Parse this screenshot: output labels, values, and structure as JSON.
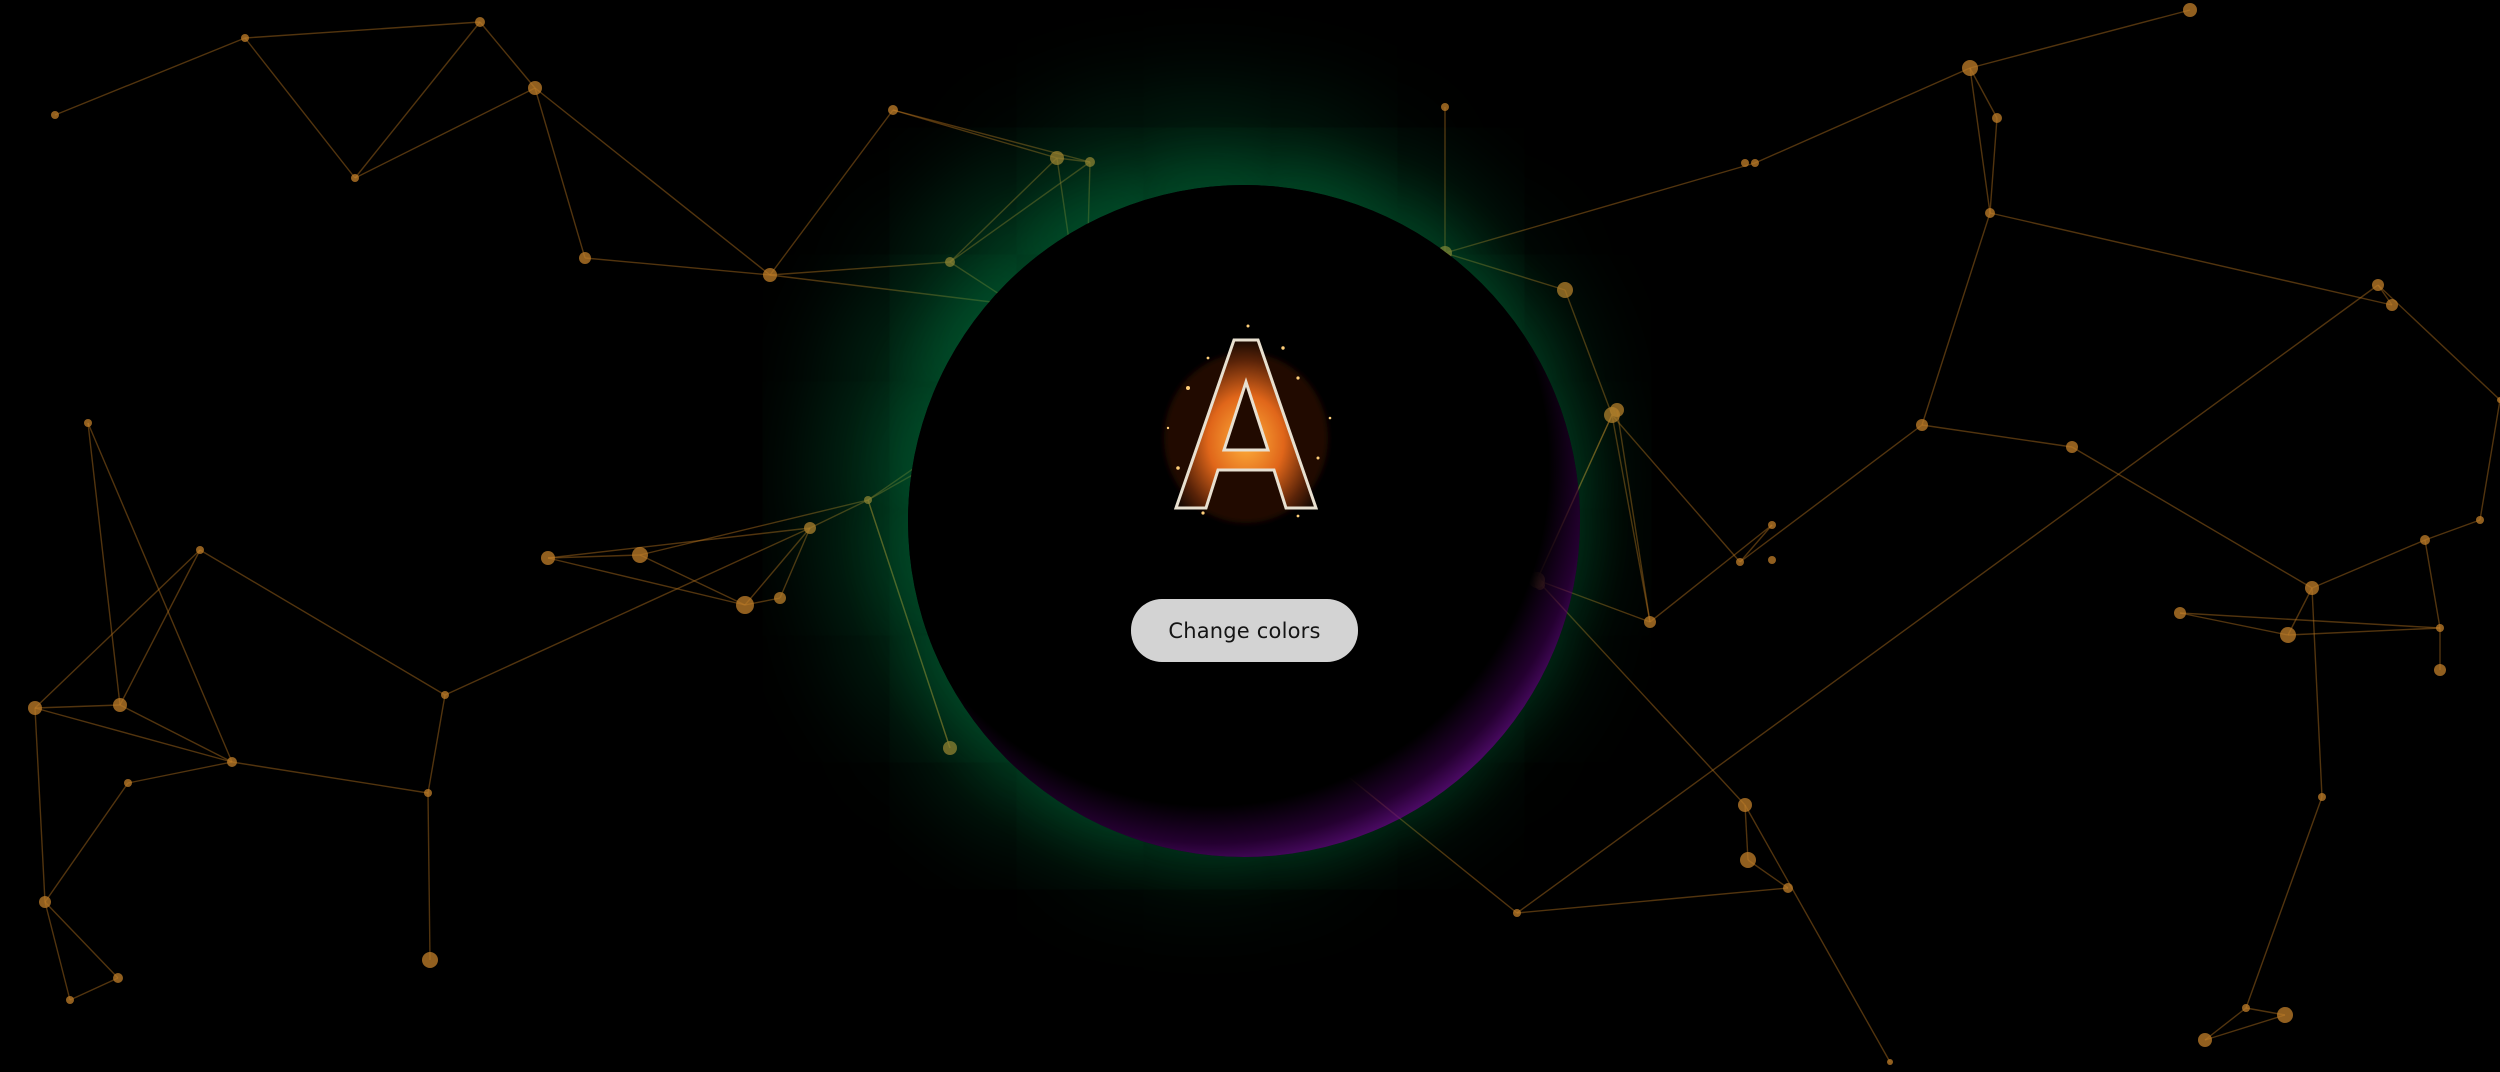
{
  "button": {
    "label": "Change colors"
  },
  "logo": {
    "letter": "A",
    "icon": "fire-letter-a-logo"
  },
  "colors": {
    "background": "#000000",
    "network_line": "#b5731f",
    "network_node": "#c27f2a",
    "orb_glow_green": "#00a65a",
    "orb_rim_purple": "#a332c9",
    "button_bg": "#d3d3d3",
    "button_text": "#141414"
  }
}
